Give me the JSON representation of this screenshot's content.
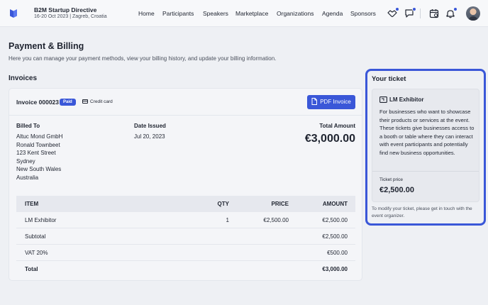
{
  "header": {
    "event_name": "B2M Startup Directive",
    "event_sub": "16-20 Oct 2023 | Zagreb, Croatia",
    "nav": [
      "Home",
      "Participants",
      "Speakers",
      "Marketplace",
      "Organizations",
      "Agenda",
      "Sponsors"
    ],
    "icons": [
      "handshake-icon",
      "chat-icon",
      "calendar-icon",
      "bell-icon"
    ],
    "accent": "#3a57d8"
  },
  "page": {
    "title": "Payment & Billing",
    "description": "Here you can manage your payment methods, view your billing history, and update your billing information.",
    "invoices_title": "Invoices"
  },
  "invoice": {
    "number": "Invoice 000023",
    "status": "Paid",
    "method": "Credit card",
    "pdf_label": "PDF Invoice",
    "billed_to_label": "Billed To",
    "billed_to": [
      "Altuc Mond GmbH",
      "Ronald Townbeet",
      "123 Kent Street",
      "Sydney",
      "New South Wales",
      "Australia"
    ],
    "date_label": "Date Issued",
    "date": "Jul 20, 2023",
    "total_label": "Total Amount",
    "total": "€3,000.00",
    "table": {
      "headers": {
        "item": "ITEM",
        "qty": "QTY",
        "price": "PRICE",
        "amount": "AMOUNT"
      },
      "rows": [
        {
          "item": "LM Exhibitor",
          "qty": "1",
          "price": "€2,500.00",
          "amount": "€2,500.00"
        }
      ],
      "subtotal_label": "Subtotal",
      "subtotal": "€2,500.00",
      "vat_label": "VAT 20%",
      "vat": "€500.00",
      "total_label": "Total",
      "total": "€3,000.00"
    }
  },
  "ticket": {
    "title": "Your ticket",
    "name": "LM Exhibitor",
    "description": "For businesses who want to showcase their products or services at the event. These tickets give businesses access to a booth or table where they can interact with event participants and potentially find new business opportunities.",
    "price_label": "Ticket price",
    "price": "€2,500.00",
    "note": "To modify your ticket, please get in touch with the event organizer."
  }
}
